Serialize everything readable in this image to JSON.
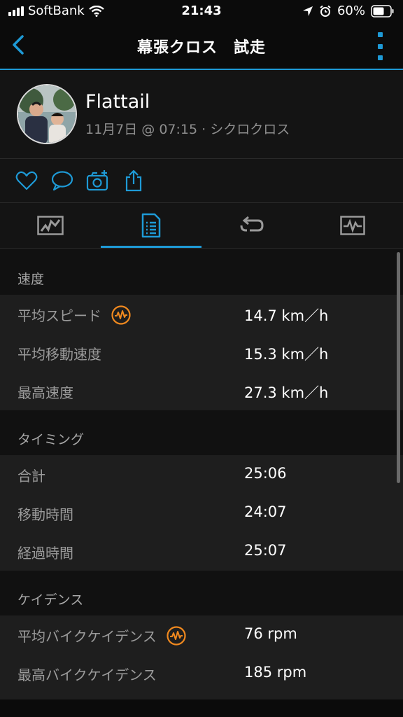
{
  "status_bar": {
    "carrier": "SoftBank",
    "time": "21:43",
    "battery_percent": "60%"
  },
  "nav": {
    "title": "幕張クロス　試走"
  },
  "activity": {
    "user_name": "Flattail",
    "meta": "11月7日 @ 07:15 · シクロクロス"
  },
  "tabs": [
    {
      "icon": "map-icon",
      "selected": false
    },
    {
      "icon": "stats-list-icon",
      "selected": true
    },
    {
      "icon": "laps-icon",
      "selected": false
    },
    {
      "icon": "chart-icon",
      "selected": false
    }
  ],
  "sections": {
    "speed": {
      "title": "速度",
      "rows": [
        {
          "label": "平均スピード",
          "value": "14.7 km／h",
          "badge": "performance-icon"
        },
        {
          "label": "平均移動速度",
          "value": "15.3 km／h"
        },
        {
          "label": "最高速度",
          "value": "27.3 km／h"
        }
      ]
    },
    "timing": {
      "title": "タイミング",
      "rows": [
        {
          "label": "合計",
          "value": "25:06"
        },
        {
          "label": "移動時間",
          "value": "24:07"
        },
        {
          "label": "経過時間",
          "value": "25:07"
        }
      ]
    },
    "cadence": {
      "title": "ケイデンス",
      "rows": [
        {
          "label": "平均バイクケイデンス",
          "value": "76 rpm",
          "badge": "performance-icon"
        },
        {
          "label": "最高バイクケイデンス",
          "value": "185 rpm"
        }
      ]
    }
  },
  "colors": {
    "accent": "#1e9ad6",
    "badge": "#f0891f",
    "background": "#0b0b0b",
    "row": "#1e1e1e"
  }
}
